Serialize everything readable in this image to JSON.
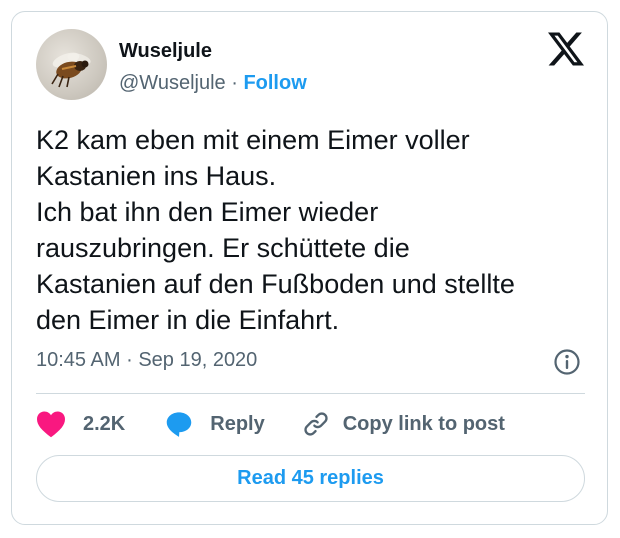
{
  "author": {
    "display_name": "Wuseljule",
    "handle": "@Wuseljule",
    "separator": "·",
    "follow_label": "Follow",
    "avatar_icon": "bee-photo-avatar"
  },
  "logo_icon": "x-logo-icon",
  "tweet": {
    "text": "K2 kam eben mit einem Eimer voller\nKastanien ins Haus.\nIch bat ihn den Eimer wieder\nrauszubringen. Er schüttete die\nKastanien auf den Fußboden und stellte\nden Eimer in die Einfahrt.",
    "time": "10:45 AM",
    "meta_separator": "·",
    "date": "Sep 19, 2020"
  },
  "actions": {
    "like_count": "2.2K",
    "reply_label": "Reply",
    "copy_label": "Copy link to post"
  },
  "read_replies_label": "Read 45 replies",
  "colors": {
    "accent": "#1d9bf0",
    "like": "#f91880",
    "text": "#0f1419",
    "muted": "#536471",
    "border": "#cfd9de"
  }
}
